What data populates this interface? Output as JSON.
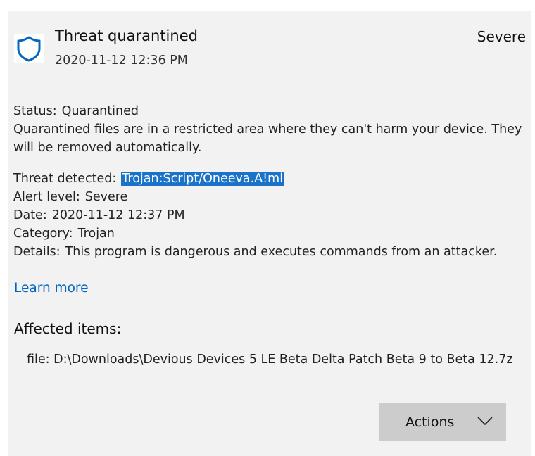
{
  "header": {
    "title": "Threat quarantined",
    "timestamp": "2020-11-12 12:36 PM",
    "severity": "Severe",
    "icon": "shield-icon"
  },
  "status": {
    "label": "Status:",
    "value": "Quarantined",
    "description": "Quarantined files are in a restricted area where they can't harm your device. They will be removed automatically."
  },
  "details": {
    "threat_label": "Threat detected:",
    "threat_value": "Trojan:Script/Oneeva.A!ml",
    "alert_label": "Alert level:",
    "alert_value": "Severe",
    "date_label": "Date:",
    "date_value": "2020-11-12 12:37 PM",
    "category_label": "Category:",
    "category_value": "Trojan",
    "details_label": "Details:",
    "details_value": "This program is dangerous and executes commands from an attacker."
  },
  "learn_more": "Learn more",
  "affected": {
    "title": "Affected items:",
    "items": [
      "file: D:\\Downloads\\Devious Devices 5 LE Beta Delta Patch Beta 9 to Beta 12.7z"
    ]
  },
  "actions": {
    "label": "Actions",
    "icon": "chevron-down-icon"
  },
  "colors": {
    "panel_bg": "#f2f2f2",
    "accent": "#0067c0",
    "selection": "#1a73c9",
    "button_bg": "#cccccc"
  }
}
